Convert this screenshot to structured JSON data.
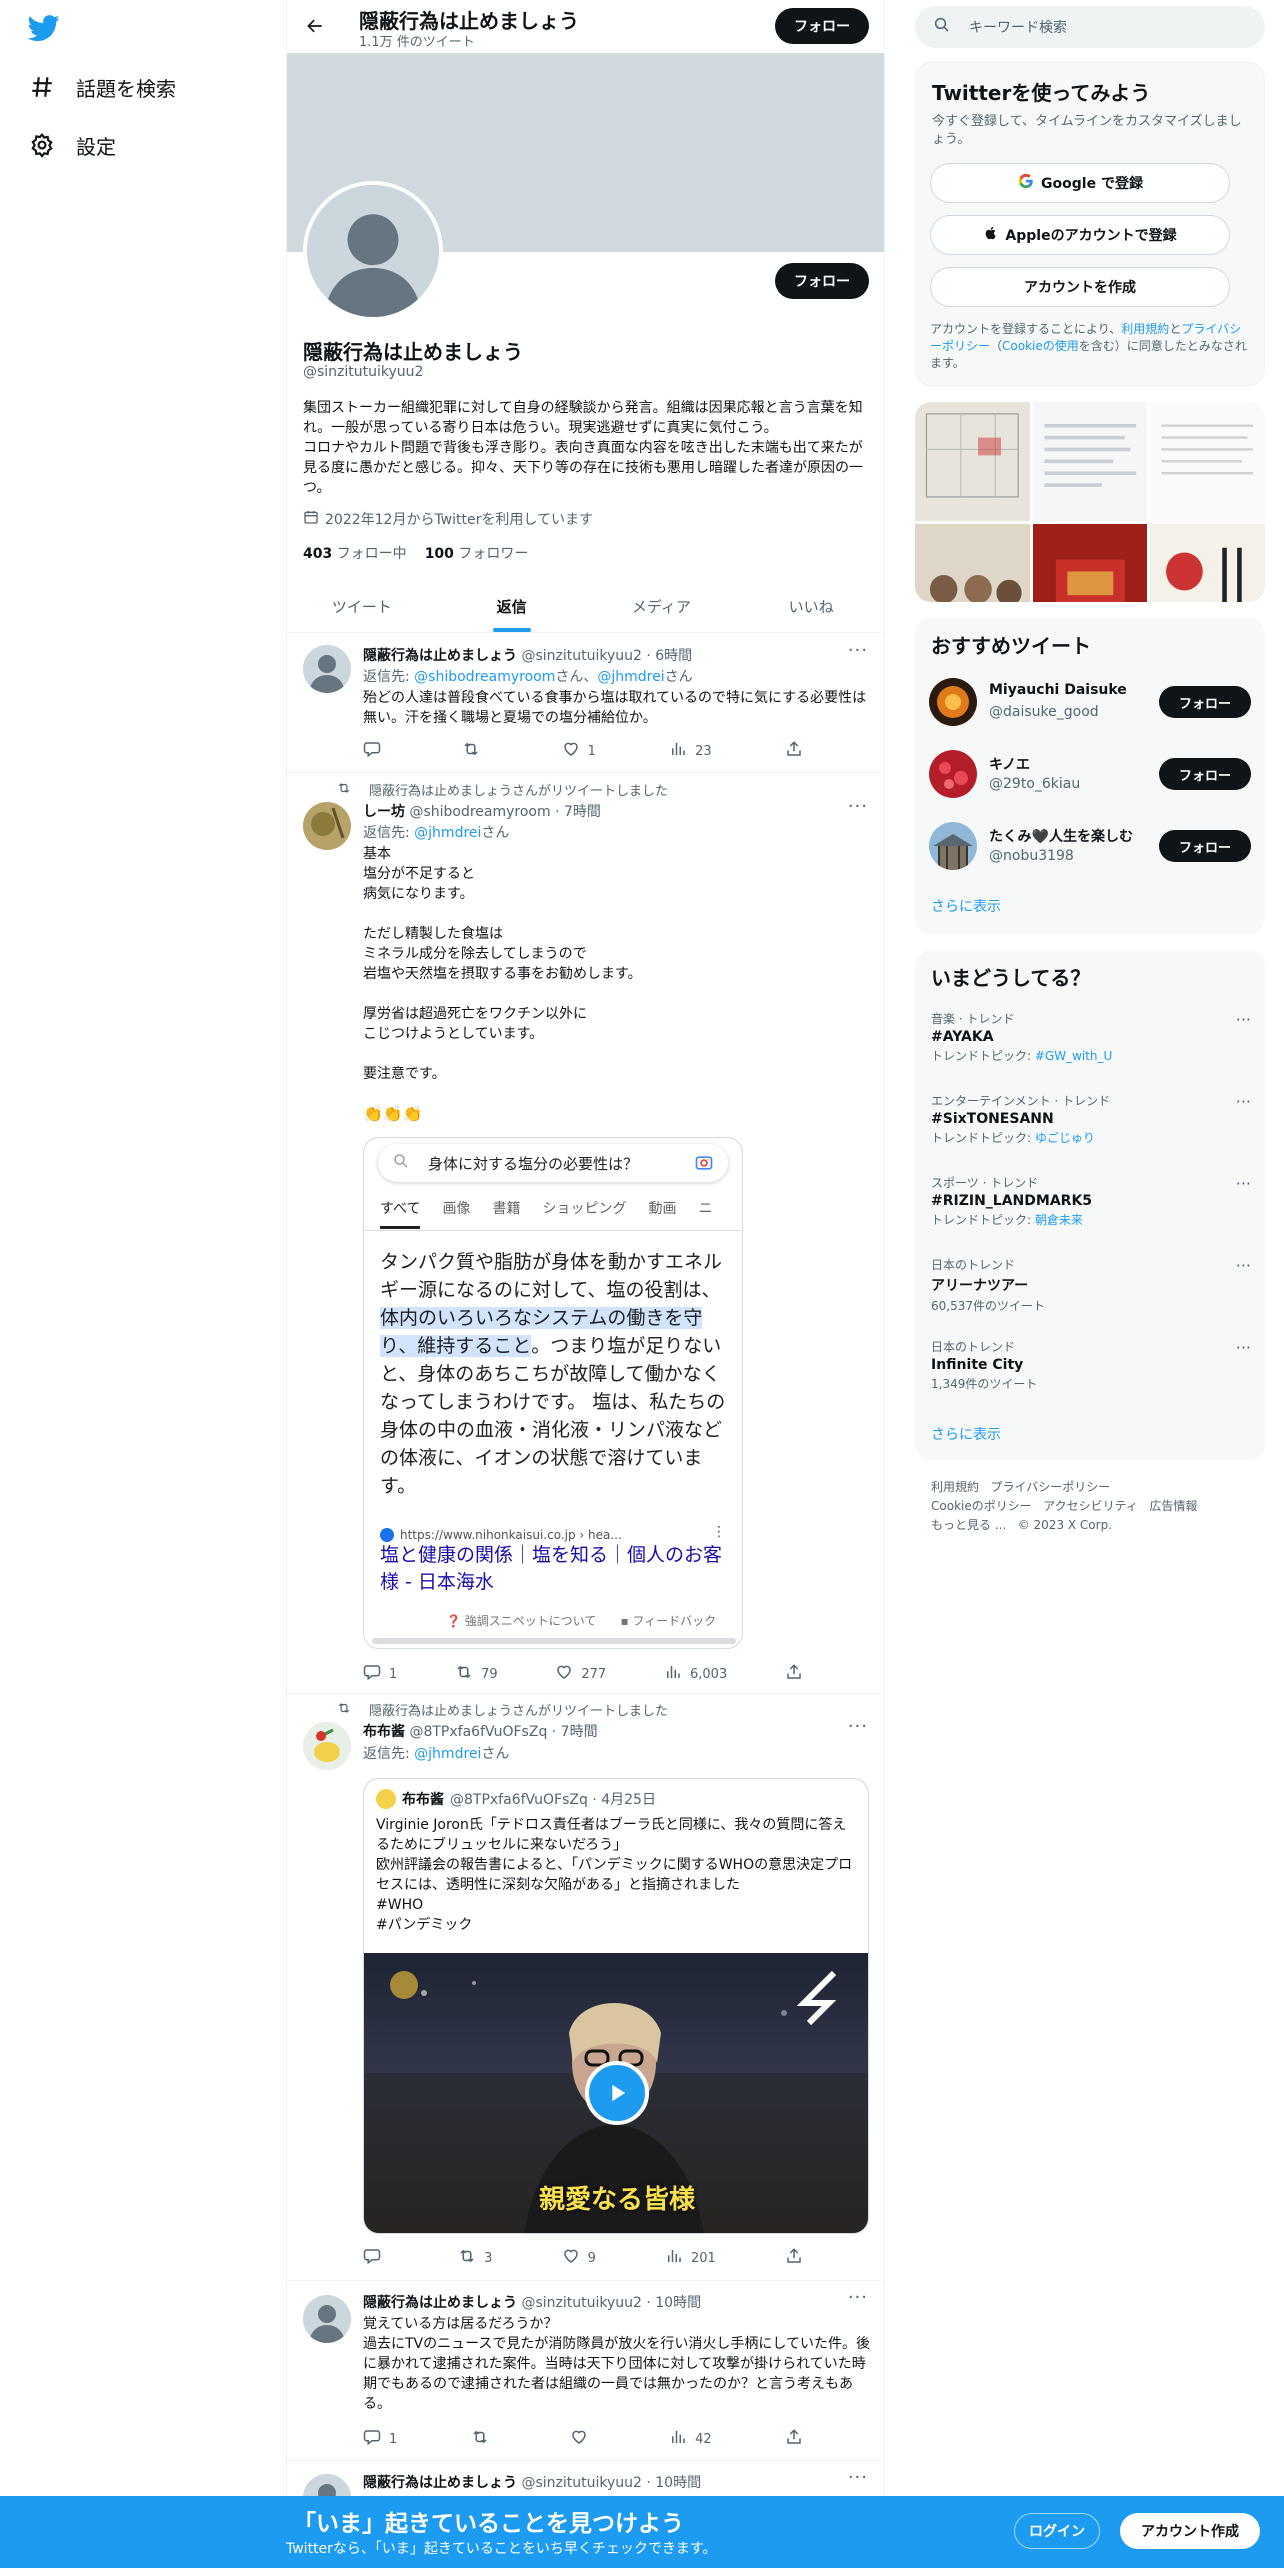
{
  "nav": {
    "explore_label": "話題を検索",
    "settings_label": "設定"
  },
  "header": {
    "title": "隠蔽行為は止めましょう",
    "tweet_count": "1.1万 件のツイート",
    "follow_label": "フォロー"
  },
  "profile": {
    "name": "隠蔽行為は止めましょう",
    "handle": "@sinzitutuikyuu2",
    "bio": "集団ストーカー組織犯罪に対して自身の経験談から発言。組織は因果応報と言う言葉を知れ。一般が思っている寄り日本は危うい。現実逃避せずに真実に気付こう。\nコロナやカルト問題で背後も浮き彫り。表向き真面な内容を呟き出した末端も出て来たが見る度に愚かだと感じる。抑々、天下り等の存在に技術も悪用し暗躍した者達が原因の一つ。",
    "joined": "2022年12月からTwitterを利用しています",
    "following_count": "403",
    "following_label": "フォロー中",
    "followers_count": "100",
    "followers_label": "フォロワー",
    "follow_label": "フォロー"
  },
  "tabs": [
    "ツイート",
    "返信",
    "メディア",
    "いいね"
  ],
  "tweets": {
    "t1": {
      "name": "隠蔽行為は止めましょう",
      "meta": "@sinzitutuikyuu2 · 6時間",
      "reply_prefix": "返信先: ",
      "reply_to1": "@shibodreamyroom",
      "reply_mid": "さん、",
      "reply_to2": "@jhmdrei",
      "reply_suffix": "さん",
      "text": "殆どの人達は普段食べている食事から塩は取れているので特に気にする必要性は無い。汗を掻く職場と夏場での塩分補給位か。",
      "reply_count": "",
      "retweet_count": "",
      "like_count": "1",
      "view_count": "23"
    },
    "t2": {
      "retweet_label": "隠蔽行為は止めましょうさんがリツイートしました",
      "name": "しー坊",
      "meta": "@shibodreamyroom · 7時間",
      "reply_prefix": "返信先: ",
      "reply_to": "@jhmdrei",
      "reply_suffix": "さん",
      "text": "基本\n塩分が不足すると\n病気になります。\n\nただし精製した食塩は\nミネラル成分を除去してしまうので\n岩塩や天然塩を摂取する事をお勧めします。\n\n厚労省は超過死亡をワクチン以外に\nこじつけようとしています。\n\n要注意です。",
      "emoji": "👏👏👏",
      "embed": {
        "search_query": "身体に対する塩分の必要性は？",
        "tabs": [
          "すべて",
          "画像",
          "書籍",
          "ショッピング",
          "動画",
          "ニ"
        ],
        "snippet_before": "タンパク質や脂肪が身体を動かすエネルギー源になるのに対して、塩の役割は、",
        "snippet_highlight": "体内のいろいろなシステムの働きを守り、維持すること",
        "snippet_after": "。つまり塩が足りないと、身体のあちこちが故障して働かなくなってしまうわけです。 塩は、私たちの身体の中の血液・消化液・リンパ液などの体液に、イオンの状態で溶けています。",
        "source_url": "https://www.nihonkaisui.co.jp › hea...",
        "link_title": "塩と健康の関係｜塩を知る｜個人のお客様 - 日本海水",
        "about_label": "強調スニペットについて",
        "feedback_label": "フィードバック"
      },
      "reply_count": "1",
      "retweet_count": "79",
      "like_count": "277",
      "view_count": "6,003"
    },
    "t3": {
      "retweet_label": "隠蔽行為は止めましょうさんがリツイートしました",
      "name": "布布酱",
      "meta": "@8TPxfa6fVuOFsZq · 7時間",
      "reply_prefix": "返信先: ",
      "reply_to": "@jhmdrei",
      "reply_suffix": "さん",
      "quote": {
        "name": "布布酱",
        "meta": "@8TPxfa6fVuOFsZq · 4月25日",
        "text": "Virginie Joron氏「テドロス責任者はブーラ氏と同様に、我々の質問に答えるためにブリュッセルに来ないだろう」\n欧州評議会の報告書によると、「パンデミックに関するWHOの意思決定プロセスには、透明性に深刻な欠陥がある」と指摘されました\n#WHO\n#パンデミック",
        "video_caption": "親愛なる皆様"
      },
      "reply_count": "",
      "retweet_count": "3",
      "like_count": "9",
      "view_count": "201"
    },
    "t4": {
      "name": "隠蔽行為は止めましょう",
      "meta": "@sinzitutuikyuu2 · 10時間",
      "text": "覚えている方は居るだろうか？\n過去にTVのニュースで見たが消防隊員が放火を行い消火し手柄にしていた件。後に暴かれて逮捕された案件。当時は天下り団体に対して攻撃が掛けられていた時期でもあるので逮捕された者は組織の一員では無かったのか？と言う考えもある。",
      "reply_count": "1",
      "retweet_count": "",
      "like_count": "",
      "view_count": "42"
    },
    "t5": {
      "name": "隠蔽行為は止めましょう",
      "meta": "@sinzitutuikyuu2 · 10時間"
    }
  },
  "right": {
    "search_placeholder": "キーワード検索",
    "signup": {
      "title": "Twitterを使ってみよう",
      "subtitle": "今すぐ登録して、タイムラインをカスタマイズしましょう。",
      "google": "Google で登録",
      "apple": "Appleのアカウントで登録",
      "create": "アカウントを作成",
      "terms_before": "アカウントを登録することにより、",
      "terms_link1": "利用規約",
      "terms_and": "と",
      "terms_link2": "プライバシーポリシー",
      "terms_paren_open": "（",
      "terms_link3": "Cookieの使用",
      "terms_after": "を含む）に同意したとみなされます。"
    },
    "recommend": {
      "title": "おすすめツイート",
      "users": [
        {
          "name": "Miyauchi Daisuke",
          "handle": "@daisuke_good",
          "follow": "フォロー"
        },
        {
          "name": "キノエ",
          "handle": "@29to_6kiau",
          "follow": "フォロー"
        },
        {
          "name": "たくみ🖤人生を楽しむ",
          "handle": "@nobu3198",
          "follow": "フォロー"
        }
      ],
      "more": "さらに表示"
    },
    "trends": {
      "title": "いまどうしてる？",
      "items": [
        {
          "context": "音楽 · トレンド",
          "name": "#AYAKA",
          "sub_label": "トレンドトピック: ",
          "sub_link": "#GW_with_U"
        },
        {
          "context": "エンターテインメント · トレンド",
          "name": "#SixTONESANN",
          "sub_label": "トレンドトピック: ",
          "sub_link": "ゆごじゅり"
        },
        {
          "context": "スポーツ · トレンド",
          "name": "#RIZIN_LANDMARK5",
          "sub_label": "トレンドトピック: ",
          "sub_link": "朝倉未来"
        },
        {
          "context": "日本のトレンド",
          "name": "アリーナツアー",
          "sub_label": "60,537件のツイート",
          "sub_link": ""
        },
        {
          "context": "日本のトレンド",
          "name": "Infinite City",
          "sub_label": "1,349件のツイート",
          "sub_link": ""
        }
      ],
      "more": "さらに表示"
    },
    "footer": {
      "terms": "利用規約",
      "privacy": "プライバシーポリシー",
      "cookie": "Cookieのポリシー",
      "accessibility": "アクセシビリティ",
      "ads": "広告情報",
      "more": "もっと見る ...",
      "copyright": "© 2023 X Corp."
    }
  },
  "bottom": {
    "title": "「いま」起きていることを見つけよう",
    "subtitle": "Twitterなら、「いま」起きていることをいち早くチェックできます。",
    "login": "ログイン",
    "signup": "アカウント作成"
  }
}
